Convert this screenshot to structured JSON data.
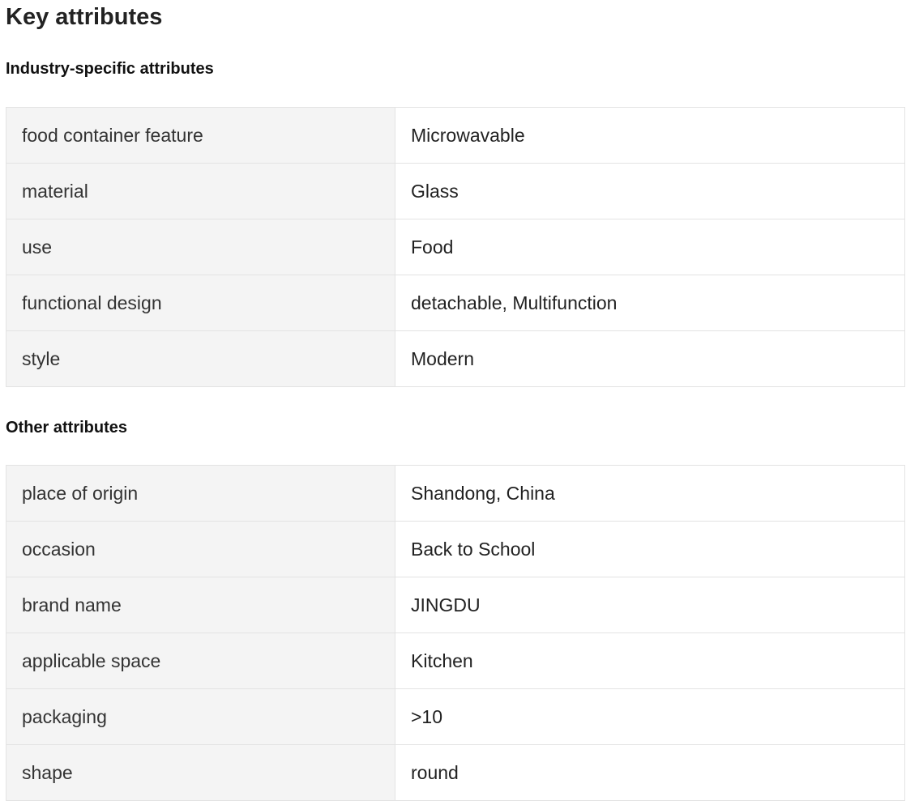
{
  "page": {
    "title": "Key attributes"
  },
  "sections": [
    {
      "title": "Industry-specific attributes",
      "rows": [
        {
          "name": "food container feature",
          "value": "Microwavable"
        },
        {
          "name": "material",
          "value": "Glass"
        },
        {
          "name": "use",
          "value": "Food"
        },
        {
          "name": "functional design",
          "value": "detachable, Multifunction"
        },
        {
          "name": "style",
          "value": "Modern"
        }
      ]
    },
    {
      "title": "Other attributes",
      "rows": [
        {
          "name": "place of origin",
          "value": "Shandong, China"
        },
        {
          "name": "occasion",
          "value": "Back to School"
        },
        {
          "name": "brand name",
          "value": "JINGDU"
        },
        {
          "name": "applicable space",
          "value": "Kitchen"
        },
        {
          "name": "packaging",
          "value": ">10"
        },
        {
          "name": "shape",
          "value": "round"
        }
      ]
    }
  ]
}
